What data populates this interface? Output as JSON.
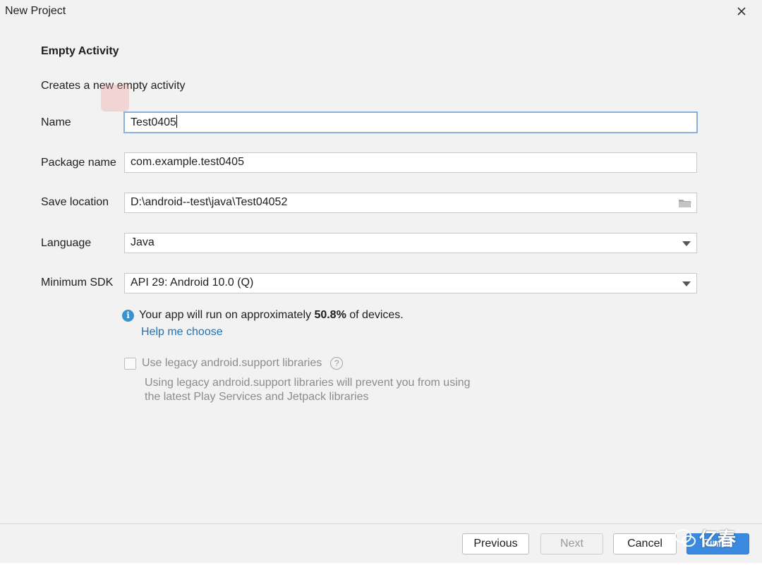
{
  "window": {
    "title": "New Project"
  },
  "heading": "Empty Activity",
  "description": "Creates a new empty activity",
  "fields": {
    "name": {
      "label": "Name",
      "value": "Test0405"
    },
    "package": {
      "label": "Package name",
      "value": "com.example.test0405"
    },
    "location": {
      "label": "Save location",
      "value": "D:\\android--test\\java\\Test04052"
    },
    "language": {
      "label": "Language",
      "value": "Java"
    },
    "min_sdk": {
      "label": "Minimum SDK",
      "value": "API 29: Android 10.0 (Q)"
    }
  },
  "info": {
    "prefix": "Your app will run on approximately ",
    "percent": "50.8%",
    "suffix": " of devices.",
    "link": "Help me choose"
  },
  "legacy": {
    "label": "Use legacy android.support libraries",
    "checked": false,
    "note_line1": "Using legacy android.support libraries will prevent you from using",
    "note_line2": "the latest Play Services and Jetpack libraries"
  },
  "buttons": {
    "previous": "Previous",
    "next": "Next",
    "cancel": "Cancel",
    "finish": "Finish"
  },
  "watermark": {
    "text": "亿春"
  },
  "colors": {
    "accent": "#3a8ae0",
    "link": "#2470b3",
    "focus": "#87b2dd"
  }
}
